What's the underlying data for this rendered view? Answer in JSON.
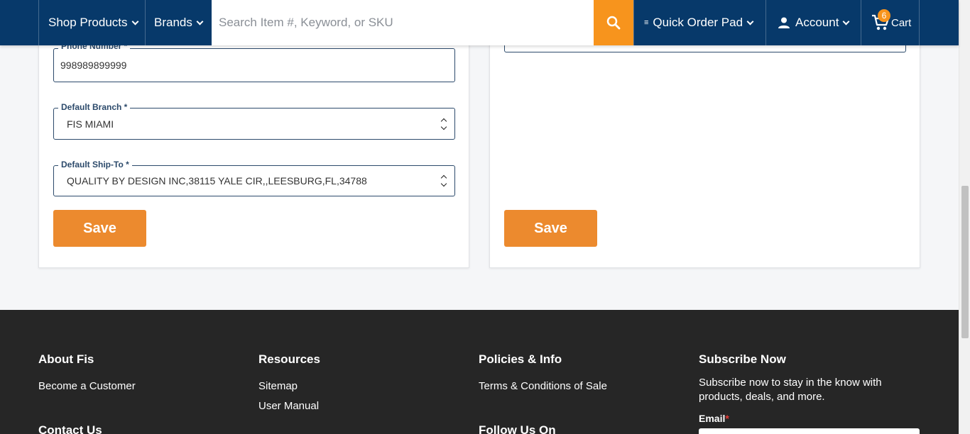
{
  "header": {
    "shop_products": "Shop Products",
    "brands": "Brands",
    "search_placeholder": "Search Item #, Keyword, or SKU",
    "quick_order_pad": "Quick Order Pad",
    "account": "Account",
    "cart": "Cart",
    "cart_count": "6"
  },
  "form": {
    "phone_label": "Phone Number *",
    "phone_value": "998989899999",
    "branch_label": "Default Branch *",
    "branch_value": "FIS MIAMI",
    "shipto_label": "Default Ship-To *",
    "shipto_value": "QUALITY BY DESIGN INC,38115 YALE CIR,,LEESBURG,FL,34788",
    "save_left": "Save",
    "save_right": "Save"
  },
  "footer": {
    "about_heading": "About Fis",
    "become_customer": "Become a Customer",
    "contact_heading": "Contact Us",
    "resources_heading": "Resources",
    "sitemap": "Sitemap",
    "user_manual": "User Manual",
    "policies_heading": "Policies & Info",
    "terms": "Terms & Conditions of Sale",
    "follow_heading": "Follow Us On",
    "subscribe_heading": "Subscribe Now",
    "subscribe_text": "Subscribe now to stay in the know with products, deals, and more.",
    "email_label": "Email",
    "email_required": "*"
  },
  "colors": {
    "header_bg": "#07396a",
    "accent": "#f7941d",
    "save_button": "#ec8a2e",
    "footer_bg": "#262626"
  }
}
